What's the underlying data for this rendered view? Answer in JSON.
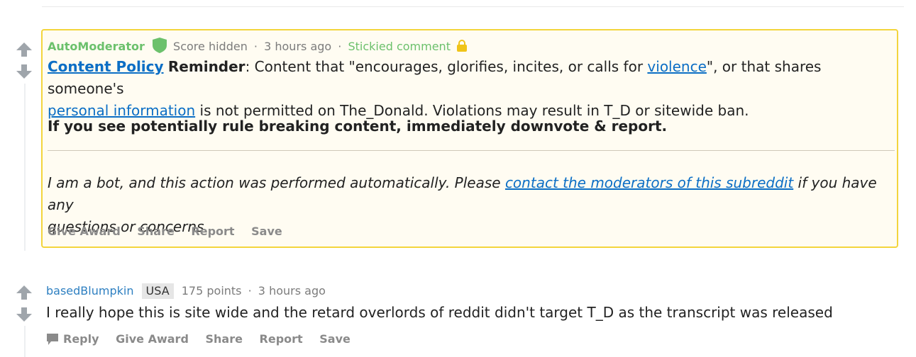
{
  "sticky_comment": {
    "author": "AutoModerator",
    "score": "Score hidden",
    "time": "3 hours ago",
    "stickied_label": "Stickied comment",
    "link_content_policy": "Content Policy",
    "reminder_label": "Reminder",
    "text_1": ": Content that \"encourages, glorifies, incites, or calls for ",
    "link_violence": "violence",
    "text_2": "\", or that shares someone's",
    "link_personal_info": "personal information",
    "text_3": " is not permitted on The_Donald. Violations may result in T_D or sitewide ban.",
    "bold_paragraph": "If you see potentially rule breaking content, immediately downvote & report.",
    "bot_text_1": "I am a bot, and this action was performed automatically. Please ",
    "bot_link": "contact the moderators of this subreddit",
    "bot_text_2": " if you have any",
    "bot_text_3": "questions or concerns.",
    "actions": [
      "Give Award",
      "Share",
      "Report",
      "Save"
    ]
  },
  "comment": {
    "author": "basedBlumpkin",
    "flair": "USA",
    "points": "175 points",
    "time": "3 hours ago",
    "text": "I really hope this is site wide and the retard overlords of reddit didn't target T_D as the transcript was released",
    "reply_label": "Reply",
    "actions": [
      "Give Award",
      "Share",
      "Report",
      "Save"
    ]
  },
  "colors": {
    "sticky_border": "#f3d53d",
    "mod_green": "#6cc16c",
    "link_blue": "#0b6ec5"
  },
  "icons": [
    "upvote-icon",
    "downvote-icon",
    "shield-icon",
    "lock-icon",
    "comment-icon"
  ]
}
